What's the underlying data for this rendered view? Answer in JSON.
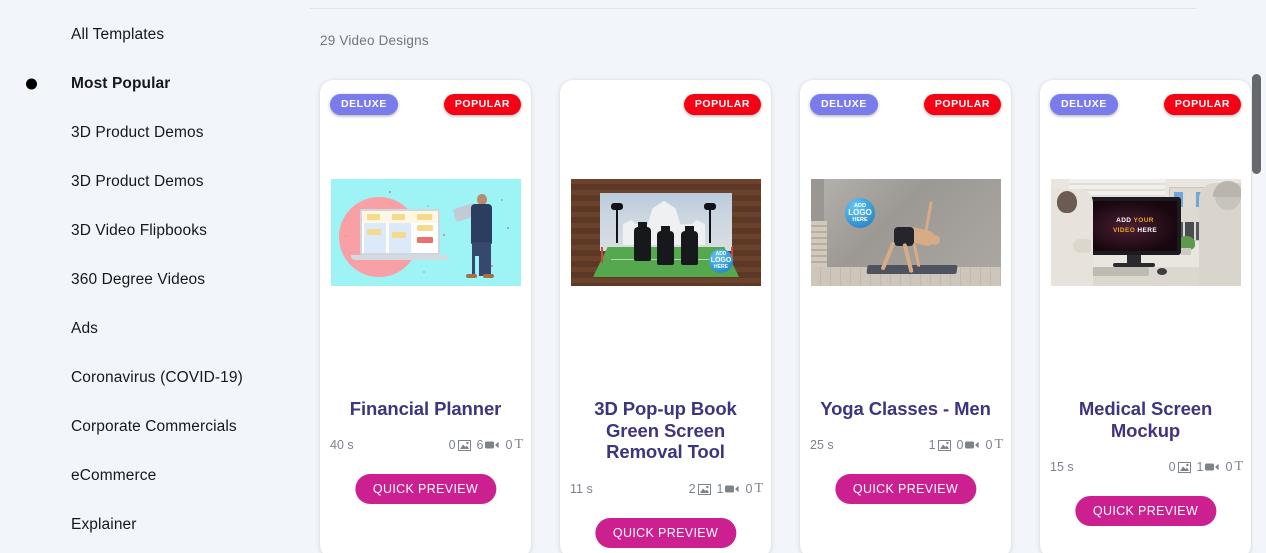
{
  "sidebar": {
    "items": [
      {
        "label": "All Templates",
        "active": false,
        "bullet": false
      },
      {
        "label": "Most Popular",
        "active": true,
        "bullet": true
      },
      {
        "label": "3D Product Demos",
        "active": false,
        "bullet": false
      },
      {
        "label": "3D Product Demos",
        "active": false,
        "bullet": false
      },
      {
        "label": "3D Video Flipbooks",
        "active": false,
        "bullet": false
      },
      {
        "label": "360 Degree Videos",
        "active": false,
        "bullet": false
      },
      {
        "label": "Ads",
        "active": false,
        "bullet": false
      },
      {
        "label": "Coronavirus (COVID-19)",
        "active": false,
        "bullet": false
      },
      {
        "label": "Corporate Commercials",
        "active": false,
        "bullet": false
      },
      {
        "label": "eCommerce",
        "active": false,
        "bullet": false
      },
      {
        "label": "Explainer",
        "active": false,
        "bullet": false
      }
    ]
  },
  "main": {
    "results_count_label": "29 Video Designs",
    "quick_preview_label": "QUICK PREVIEW",
    "badge_deluxe_label": "DELUXE",
    "badge_popular_label": "POPULAR",
    "logo_placeholder_top": "ADD",
    "logo_placeholder_mid": "LOGO",
    "logo_placeholder_bottom": "HERE",
    "screen_text_line1_a": "ADD",
    "screen_text_line1_b": "YOUR",
    "screen_text_line2_a": "VIDEO",
    "screen_text_line2_b": "HERE"
  },
  "cards": [
    {
      "title": "Financial Planner",
      "duration": "40 s",
      "images": "0",
      "videos": "6",
      "texts": "0",
      "text_glyph": "T",
      "badges": {
        "deluxe": "DELUXE",
        "popular": "POPULAR"
      },
      "quick_preview": "QUICK PREVIEW"
    },
    {
      "title": "3D Pop-up Book Green Screen Removal Tool",
      "duration": "11 s",
      "images": "2",
      "videos": "1",
      "texts": "0",
      "text_glyph": "T",
      "badges": {
        "deluxe": null,
        "popular": "POPULAR"
      },
      "quick_preview": "QUICK PREVIEW"
    },
    {
      "title": "Yoga Classes - Men",
      "duration": "25 s",
      "images": "1",
      "videos": "0",
      "texts": "0",
      "text_glyph": "T",
      "badges": {
        "deluxe": "DELUXE",
        "popular": "POPULAR"
      },
      "quick_preview": "QUICK PREVIEW"
    },
    {
      "title": "Medical Screen Mockup",
      "duration": "15 s",
      "images": "0",
      "videos": "1",
      "texts": "0",
      "text_glyph": "T",
      "badges": {
        "deluxe": "DELUXE",
        "popular": "POPULAR"
      },
      "quick_preview": "QUICK PREVIEW"
    }
  ],
  "colors": {
    "page_background": "#f2f5fa",
    "card_background": "#ffffff",
    "title_indigo": "#3c3580",
    "badge_deluxe": "#7b7ceb",
    "badge_popular": "#f60215",
    "quick_preview_magenta": "#cc1f90",
    "meta_grey": "#7d838c",
    "scrollbar_thumb": "#65696e"
  }
}
